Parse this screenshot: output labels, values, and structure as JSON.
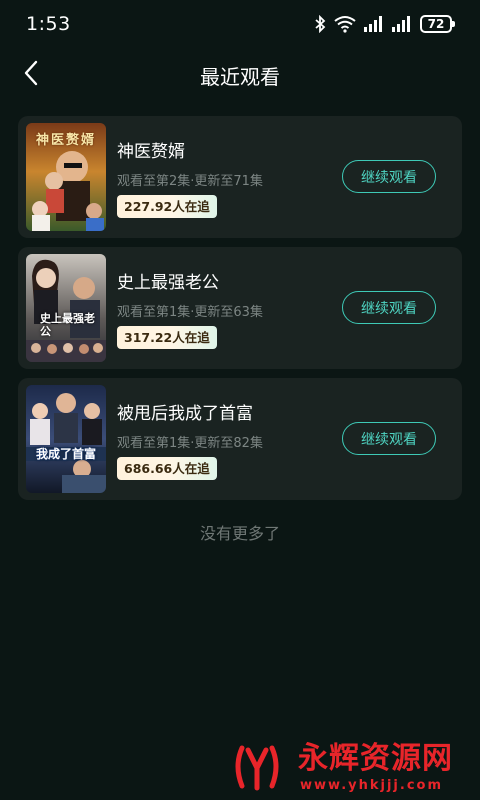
{
  "status_bar": {
    "time": "1:53",
    "battery": "72",
    "icons": [
      "bluetooth-icon",
      "wifi-icon",
      "signal-icon",
      "signal-icon",
      "battery-icon"
    ]
  },
  "header": {
    "title": "最近观看",
    "back_icon": "back-arrow-icon"
  },
  "history": [
    {
      "title": "神医赘婿",
      "progress": "观看至第2集·更新至71集",
      "followers": "227.92人在追",
      "button": "继续观看",
      "poster_text": "神医赘婿"
    },
    {
      "title": "史上最强老公",
      "progress": "观看至第1集·更新至63集",
      "followers": "317.22人在追",
      "button": "继续观看",
      "poster_text": "史上最强老公"
    },
    {
      "title": "被甩后我成了首富",
      "progress": "观看至第1集·更新至82集",
      "followers": "686.66人在追",
      "button": "继续观看",
      "poster_text": "我成了首富"
    }
  ],
  "footer": {
    "no_more": "没有更多了"
  },
  "watermark": {
    "brand": "永辉资源网",
    "url": "www.yhkjjj.com"
  },
  "colors": {
    "background": "#0b1614",
    "card": "#1a2321",
    "accent": "#3ec9b6"
  }
}
